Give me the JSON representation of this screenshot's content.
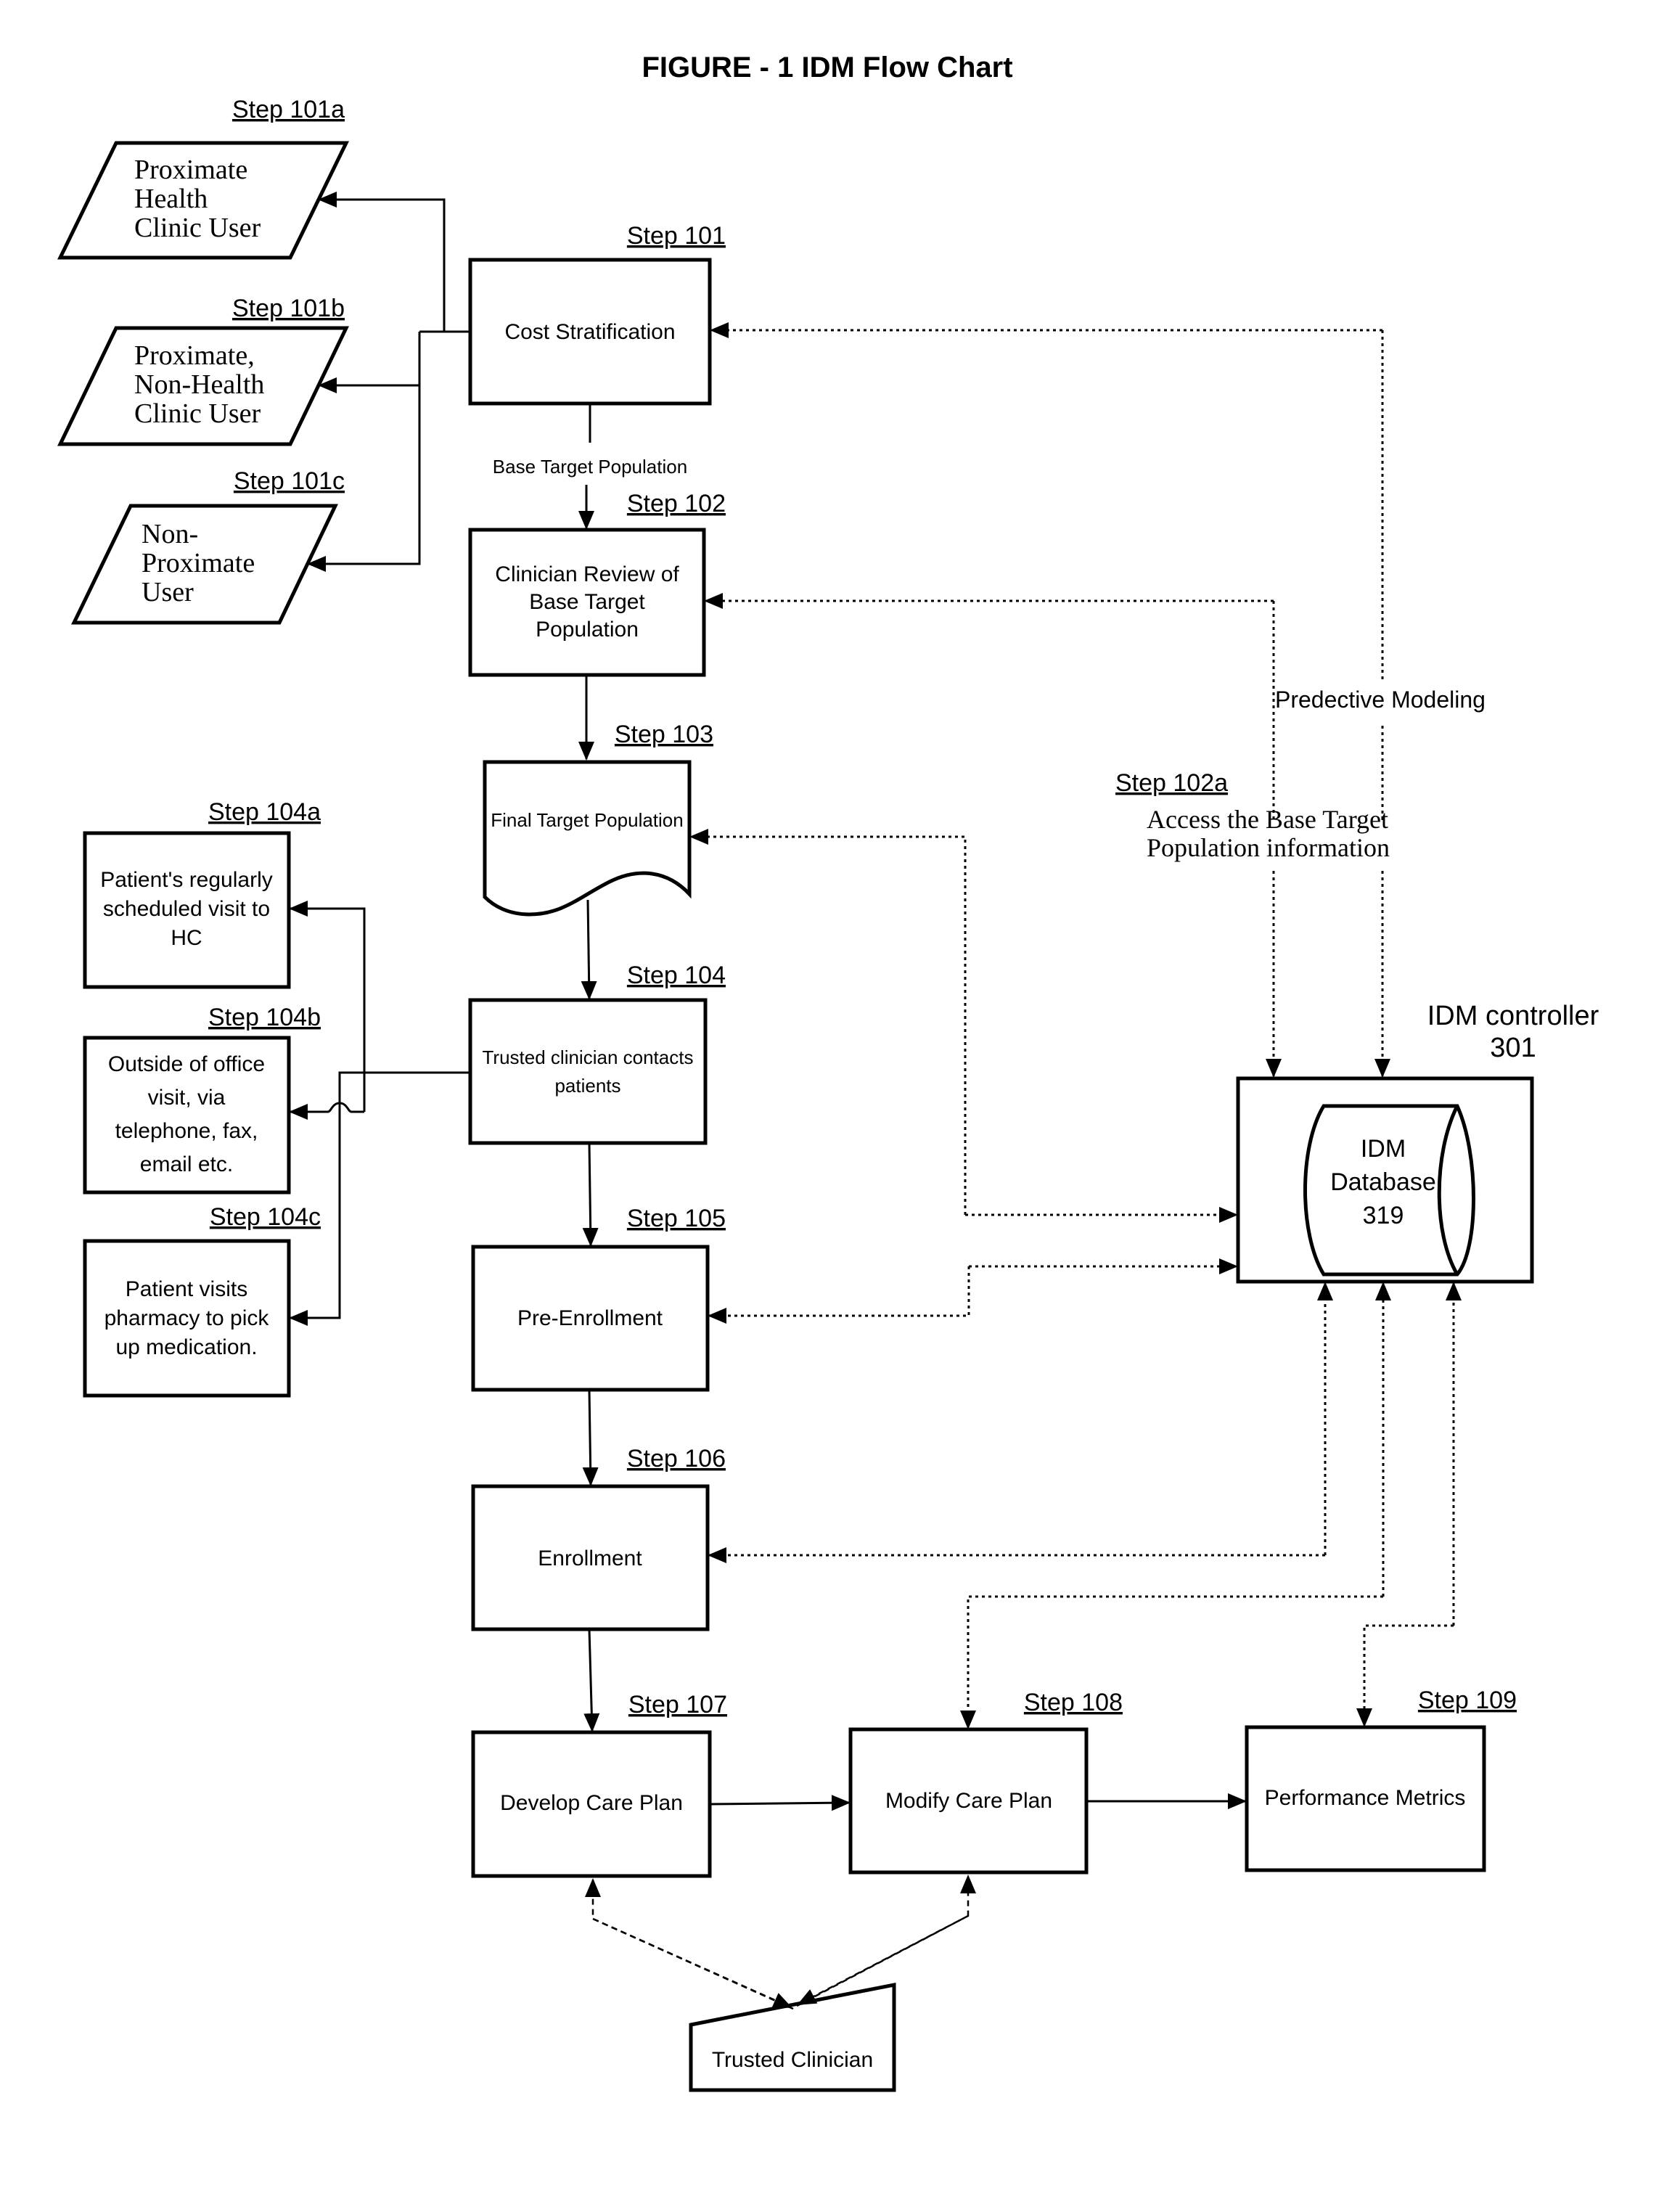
{
  "title": "FIGURE - 1  IDM Flow Chart",
  "steps": {
    "s101": {
      "step": "Step 101",
      "lines": [
        "Cost Stratification"
      ]
    },
    "s101a": {
      "step": "Step 101a",
      "lines": [
        "Proximate",
        "Health",
        "Clinic User"
      ]
    },
    "s101b": {
      "step": "Step 101b",
      "lines": [
        "Proximate,",
        "Non-Health",
        "Clinic User"
      ]
    },
    "s101c": {
      "step": "Step 101c",
      "lines": [
        "Non-",
        "Proximate",
        "User"
      ]
    },
    "s102": {
      "step": "Step 102",
      "lines": [
        "Clinician Review of",
        "Base Target",
        "Population"
      ]
    },
    "s102a": {
      "step": "Step 102a",
      "lines": [
        "Access the Base Target",
        "Population information"
      ]
    },
    "s103": {
      "step": "Step 103",
      "lines": [
        "Final Target Population"
      ]
    },
    "s104": {
      "step": "Step 104",
      "lines": [
        "Trusted clinician contacts",
        "patients"
      ]
    },
    "s104a": {
      "step": "Step 104a",
      "lines": [
        "Patient's regularly",
        "scheduled visit to",
        "HC"
      ]
    },
    "s104b": {
      "step": "Step 104b",
      "lines": [
        "Outside of office",
        "visit, via",
        "telephone, fax,",
        "email etc."
      ]
    },
    "s104c": {
      "step": "Step 104c",
      "lines": [
        "Patient visits",
        "pharmacy to pick",
        "up medication."
      ]
    },
    "s105": {
      "step": "Step 105",
      "lines": [
        "Pre-Enrollment"
      ]
    },
    "s106": {
      "step": "Step 106",
      "lines": [
        "Enrollment"
      ]
    },
    "s107": {
      "step": "Step 107",
      "lines": [
        "Develop Care Plan"
      ]
    },
    "s108": {
      "step": "Step 108",
      "lines": [
        "Modify Care Plan"
      ]
    },
    "s109": {
      "step": "Step 109",
      "lines": [
        "Performance Metrics"
      ]
    }
  },
  "connector_labels": {
    "base_target_population": "Base Target Population",
    "predictive_modeling": "Predective Modeling"
  },
  "controller": {
    "title_line1": "IDM controller",
    "title_line2": "301",
    "database_lines": [
      "IDM",
      "Database",
      "319"
    ]
  },
  "trusted_clinician": "Trusted Clinician"
}
